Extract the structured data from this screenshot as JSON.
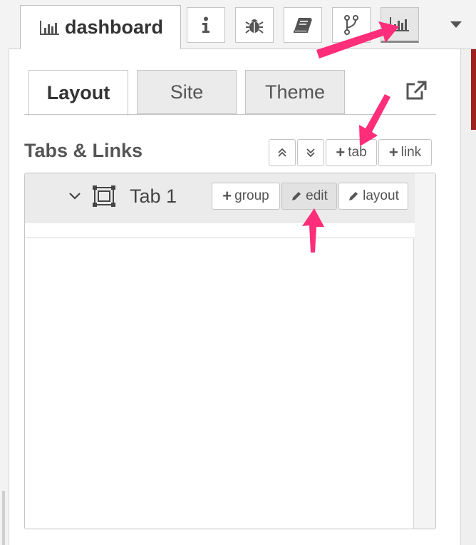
{
  "header": {
    "title": "dashboard",
    "icon_buttons": [
      {
        "name": "info-icon"
      },
      {
        "name": "bug-icon"
      },
      {
        "name": "book-icon"
      },
      {
        "name": "git-branch-icon"
      },
      {
        "name": "chart-icon",
        "active": true
      }
    ],
    "menu_icon": "caret-down-icon"
  },
  "tabs": [
    {
      "label": "Layout",
      "active": true
    },
    {
      "label": "Site",
      "active": false
    },
    {
      "label": "Theme",
      "active": false
    }
  ],
  "section": {
    "title": "Tabs & Links",
    "buttons": {
      "collapse_all": "chevron-double-up-icon",
      "expand_all": "chevron-double-down-icon",
      "add_tab": "tab",
      "add_link": "link"
    }
  },
  "tab_list": [
    {
      "name": "Tab 1",
      "actions": {
        "group": "group",
        "edit": "edit",
        "layout": "layout"
      }
    }
  ],
  "colors": {
    "accent": "#ff2d7a",
    "border": "#c4c4c4",
    "header_bg": "#f3f3f3"
  }
}
